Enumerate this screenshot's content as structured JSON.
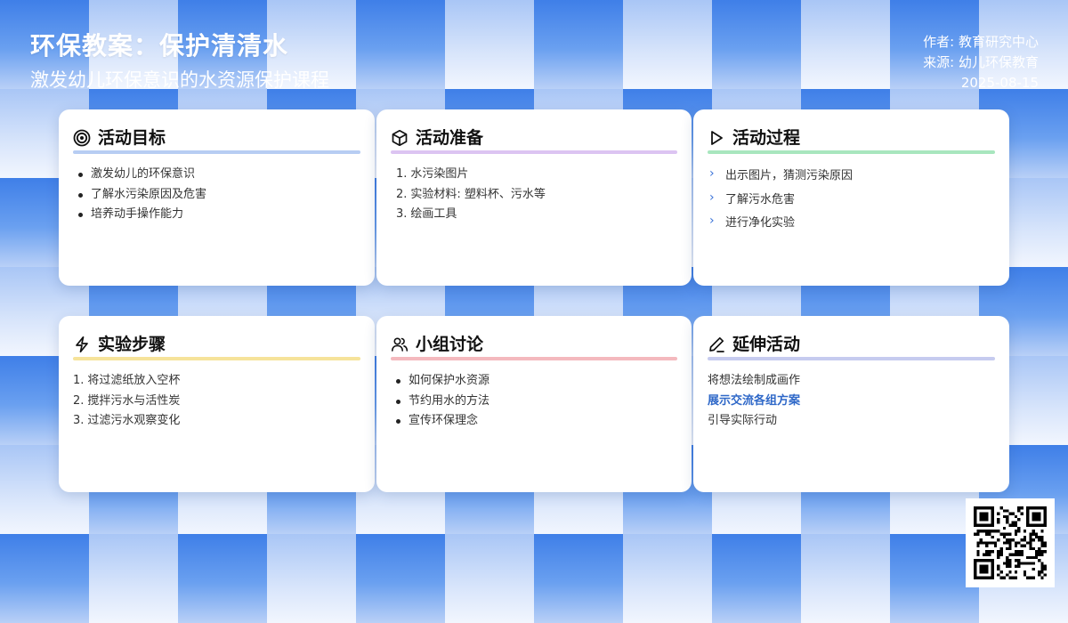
{
  "header": {
    "title": "环保教案：保护清清水",
    "subtitle": "激发幼儿环保意识的水资源保护课程"
  },
  "meta": {
    "author": "作者: 教育研究中心",
    "source": "来源: 幼儿环保教育",
    "date": "2025-08-15"
  },
  "colors": {
    "goal": "#b7cdf3",
    "prep": "#dcc4f2",
    "process": "#a8e6be",
    "steps": "#f6e39a",
    "discussion": "#f4b9be",
    "extension": "#c6cbef",
    "accent": "#3b73d8"
  },
  "cards": {
    "goal": {
      "icon": "target-icon",
      "title": "活动目标",
      "items": [
        "激发幼儿的环保意识",
        "了解水污染原因及危害",
        "培养动手操作能力"
      ]
    },
    "prep": {
      "icon": "box-icon",
      "title": "活动准备",
      "items": [
        {
          "num": "1.",
          "text": "水污染图片"
        },
        {
          "num": "2.",
          "text": "实验材料: 塑料杯、污水等"
        },
        {
          "num": "3.",
          "text": "绘画工具"
        }
      ]
    },
    "process": {
      "icon": "play-icon",
      "title": "活动过程",
      "items": [
        "出示图片，猜测污染原因",
        "了解污水危害",
        "进行净化实验"
      ]
    },
    "steps": {
      "icon": "lightning-icon",
      "title": "实验步骤",
      "items": [
        {
          "num": "1.",
          "text": "将过滤纸放入空杯"
        },
        {
          "num": "2.",
          "text": "搅拌污水与活性炭"
        },
        {
          "num": "3.",
          "text": "过滤污水观察变化"
        }
      ]
    },
    "discussion": {
      "icon": "users-icon",
      "title": "小组讨论",
      "items": [
        "如何保护水资源",
        "节约用水的方法",
        "宣传环保理念"
      ]
    },
    "extension": {
      "icon": "pencil-icon",
      "title": "延伸活动",
      "items": [
        "将想法绘制成画作",
        "展示交流各组方案",
        "引导实际行动"
      ]
    }
  },
  "qr": {
    "icon": "qr-code-icon"
  }
}
